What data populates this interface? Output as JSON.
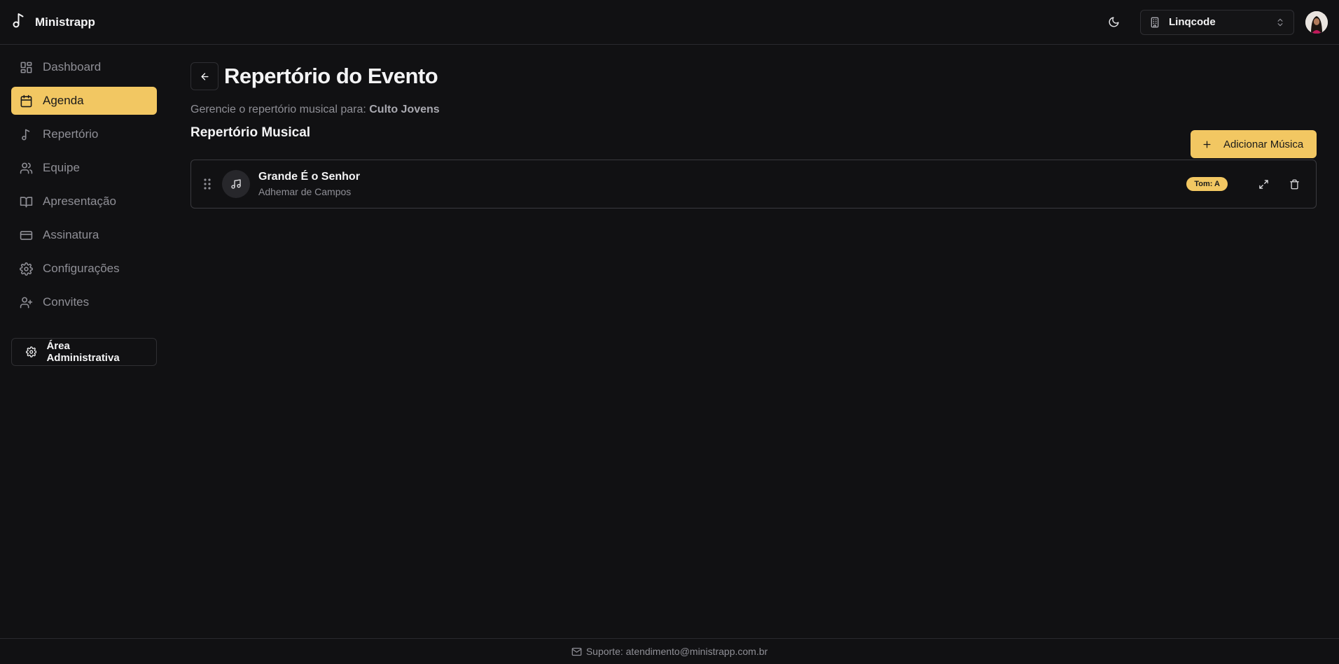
{
  "app": {
    "name": "Ministrapp"
  },
  "header": {
    "organization": "Linqcode"
  },
  "sidebar": {
    "items": [
      {
        "label": "Dashboard",
        "icon": "dashboard-icon",
        "active": false
      },
      {
        "label": "Agenda",
        "icon": "calendar-icon",
        "active": true
      },
      {
        "label": "Repertório",
        "icon": "music-note-icon",
        "active": false
      },
      {
        "label": "Equipe",
        "icon": "users-icon",
        "active": false
      },
      {
        "label": "Apresentação",
        "icon": "book-open-icon",
        "active": false
      },
      {
        "label": "Assinatura",
        "icon": "credit-card-icon",
        "active": false
      },
      {
        "label": "Configurações",
        "icon": "gear-icon",
        "active": false
      },
      {
        "label": "Convites",
        "icon": "user-plus-icon",
        "active": false
      }
    ],
    "admin_label": "Área Administrativa"
  },
  "main": {
    "title": "Repertório do Evento",
    "subtitle_prefix": "Gerencie o repertório musical para:",
    "event_name": "Culto Jovens",
    "section_title": "Repertório Musical",
    "add_button_label": "Adicionar Música",
    "songs": [
      {
        "title": "Grande É o Senhor",
        "artist": "Adhemar de Campos",
        "key": "Tom: A"
      }
    ]
  },
  "footer": {
    "support_text": "Suporte: atendimento@ministrapp.com.br"
  },
  "colors": {
    "accent": "#f2c762",
    "background": "#111113",
    "muted_text": "#8f8f96"
  }
}
